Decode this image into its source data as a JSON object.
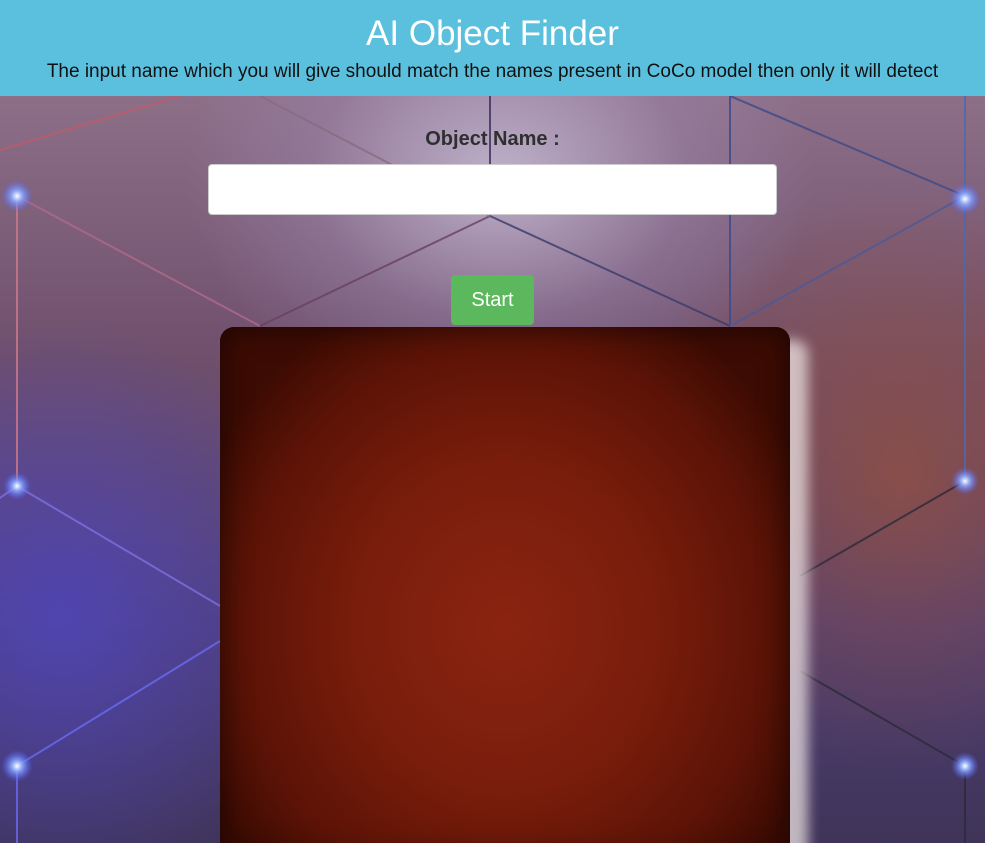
{
  "header": {
    "title": "AI Object Finder",
    "subtitle": "The input name which you will give should match the names present in CoCo model then only it will detect"
  },
  "form": {
    "label": "Object Name :",
    "input_value": "",
    "input_placeholder": "",
    "start_label": "Start"
  },
  "colors": {
    "header_bg": "#5bc0de",
    "start_button": "#5cb85c",
    "video_area": "#7a1d0c"
  }
}
